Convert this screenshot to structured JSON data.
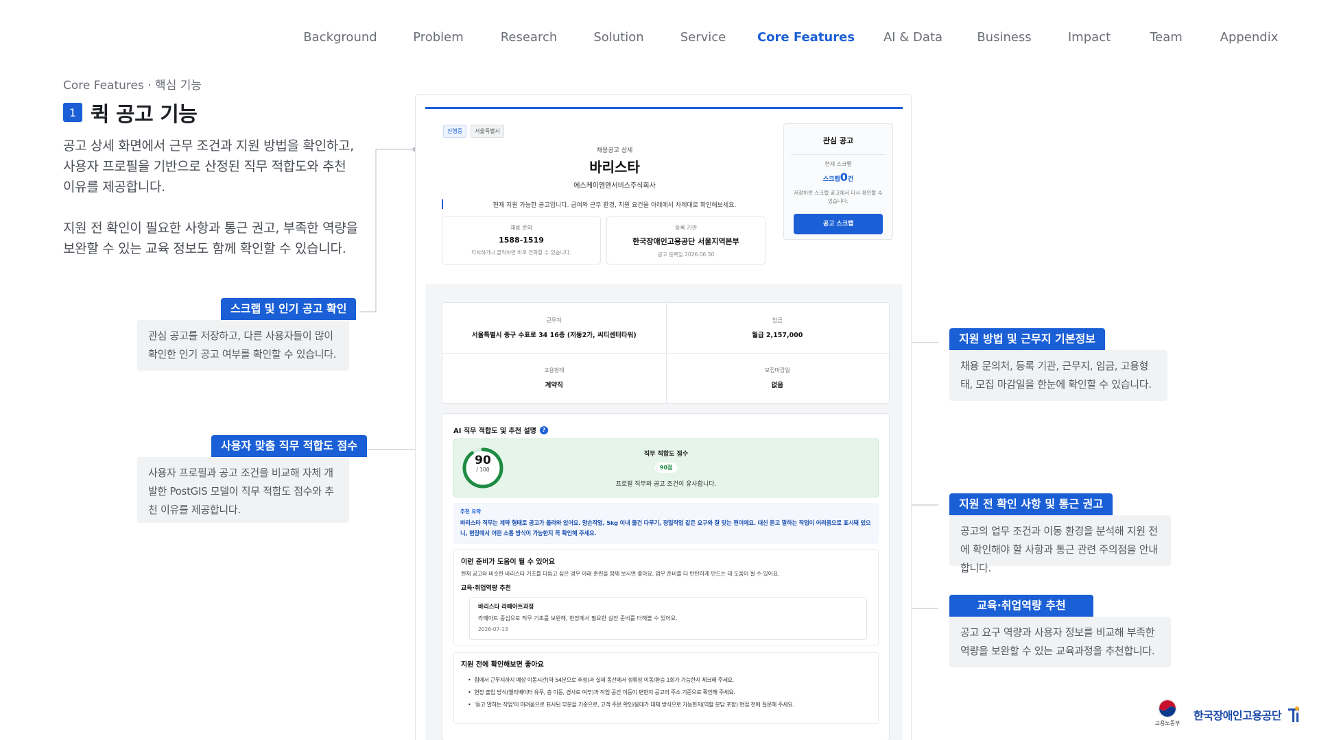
{
  "nav": {
    "items": [
      "Background",
      "Problem",
      "Research",
      "Solution",
      "Service",
      "Core Features",
      "AI & Data",
      "Business",
      "Impact",
      "Team",
      "Appendix"
    ],
    "active": "Core Features"
  },
  "header": {
    "breadcrumb": "Core Features · 핵심 기능",
    "number": "1",
    "title": "퀵 공고 기능",
    "intro_1": "공고 상세 화면에서 근무 조건과 지원 방법을 확인하고, 사용자 프로필을 기반으로 산정된 직무 적합도와 추천 이유를 제공합니다.",
    "intro_2": "지원 전 확인이 필요한 사항과 통근 권고, 부족한 역량을 보완할 수 있는 교육 정보도 함께 확인할 수 있습니다."
  },
  "callouts": {
    "scrap": {
      "tag": "스크랩 및 인기 공고 확인",
      "body": "관심 공고를 저장하고, 다른 사용자들이 많이 확인한 인기 공고 여부를 확인할 수 있습니다."
    },
    "fit": {
      "tag": "사용자 맞춤 직무 적합도 점수",
      "body": "사용자 프로필과 공고 조건을 비교해 자체 개발한 PostGIS 모델이 직무 적합도 점수와 추천 이유를 제공합니다."
    },
    "apply": {
      "tag": "지원 방법 및 근무지 기본정보",
      "body": "채용 문의처, 등록 기관, 근무지, 임금, 고용형태, 모집 마감일을 한눈에 확인할 수 있습니다."
    },
    "commute": {
      "tag": "지원 전 확인 사항 및 통근 권고",
      "body": "공고의 업무 조건과 이동 환경을 분석해 지원 전에 확인해야 할 사항과 통근 관련 주의점을 안내합니다."
    },
    "edu": {
      "tag": "교육·취업역량 추천",
      "body": "공고 요구 역량과 사용자 정보를 비교해 부족한 역량을 보완할 수 있는 교육과정을 추천합니다."
    }
  },
  "mock": {
    "chips": [
      "진행중",
      "서울특별시"
    ],
    "subtitle": "채용공고 상세",
    "job_title": "바리스타",
    "company": "에스케이엠엔서비스주식회사",
    "notice": "현재 지원 가능한 공고입니다. 급여와 근무 환경, 지원 요건을 아래에서 차례대로 확인해보세요.",
    "contact": {
      "label": "채용 문의",
      "value": "1588-1519",
      "sub": "터치하거나 클릭하면 바로 전화할 수 있습니다."
    },
    "agency": {
      "label": "등록 기관",
      "value": "한국장애인고용공단 서울지역본부",
      "sub": "공고 등록일 2026.06.30"
    },
    "fav": {
      "title": "관심 공고",
      "current": "현재 스크랩",
      "count_prefix": "스크랩",
      "count": "0",
      "count_suffix": "건",
      "desc": "저장하면 스크랩 공고에서 다시 확인할 수 있습니다.",
      "button": "공고 스크랩"
    },
    "details": {
      "workplace_label": "근무지",
      "workplace": "서울특별시 중구 수표로 34 16층 (저동2가, 씨티센터타워)",
      "wage_label": "임금",
      "wage": "월급 2,157,000",
      "type_label": "고용형태",
      "type": "계약직",
      "deadline_label": "모집마감일",
      "deadline": "없음"
    },
    "ai": {
      "title": "AI 직무 적합도 및 추천 설명",
      "score": 90,
      "score_max": "/ 100",
      "score_label": "직무 적합도 점수",
      "score_badge": "90점",
      "score_desc": "프로필 직무와 공고 조건이 유사합니다.",
      "summary_label": "추천 요약",
      "summary": "바리스타 직무는 계약 형태로 공고가 올라와 있어요. 양손작업, 5kg 이내 물건 다루기, 정밀작업 같은 요구와 잘 맞는 편이에요. 대신 듣고 말하는 작업이 어려움으로 표시돼 있으니, 현장에서 어떤 소통 방식이 가능한지 꼭 확인해 주세요.",
      "prep_title": "이런 준비가 도움이 될 수 있어요",
      "prep_text": "현재 공고와 비슷한 바리스타 기초를 다듬고 싶은 경우 아래 훈련을 함께 보시면 좋아요. 업무 준비를 더 탄탄하게 만드는 데 도움이 될 수 있어요.",
      "edu_title": "교육·취업역량 추천",
      "course_name": "바리스타 라떼아트과정",
      "course_desc": "라떼아트 중심으로 직무 기초를 보완해, 현장에서 필요한 실전 준비를 더해볼 수 있어요.",
      "course_date": "2026-07-13",
      "check_title": "지원 전에 확인해보면 좋아요",
      "checks": [
        "집에서 근무지까지 예상 이동시간(약 54분으로 추정)과 실제 동선에서 정류장 이동/환승 1회가 가능한지 체크해 주세요.",
        "현장 출입 방식(엘리베이터 유무, 층 이동, 경사로 여부)과 작업 공간 이동이 편한지 공고의 주소 기준으로 확인해 주세요.",
        "'듣고 말하는 작업'이 어려움으로 표시된 부분을 기준으로, 고객 주문 확인/응대가 대체 방식으로 가능한지(역할 분담 포함) 면접 전에 질문해 주세요."
      ]
    }
  },
  "logos": {
    "moel": "고용노동부",
    "kead": "한국장애인고용공단"
  },
  "colors": {
    "accent": "#1a5fd6",
    "score_bg": "#e6f5ea",
    "score_ring": "#1e8c43"
  }
}
